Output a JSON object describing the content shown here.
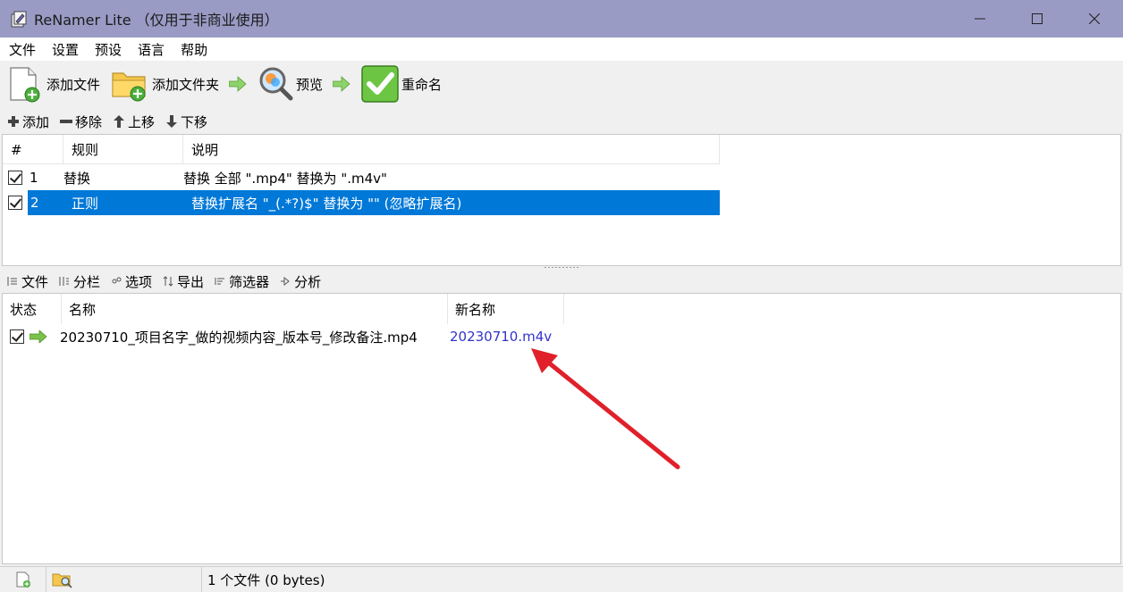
{
  "window": {
    "title": "ReNamer Lite （仅用于非商业使用）"
  },
  "menu": [
    "文件",
    "设置",
    "预设",
    "语言",
    "帮助"
  ],
  "toolbar": {
    "add_files": "添加文件",
    "add_folders": "添加文件夹",
    "preview": "预览",
    "rename": "重命名"
  },
  "rules_toolbar": {
    "add": "添加",
    "remove": "移除",
    "move_up": "上移",
    "move_down": "下移"
  },
  "rules_table": {
    "headers": [
      "#",
      "规则",
      "说明"
    ],
    "rows": [
      {
        "index": "1",
        "rule": "替换",
        "description": "替换 全部 \".mp4\" 替换为 \".m4v\"",
        "checked": true,
        "selected": false
      },
      {
        "index": "2",
        "rule": "正则",
        "description": "替换扩展名 \"_(.*?)$\" 替换为 \"\" (忽略扩展名)",
        "checked": true,
        "selected": true
      }
    ]
  },
  "files_toolbar": {
    "files": "文件",
    "columns": "分栏",
    "options": "选项",
    "export": "导出",
    "filters": "筛选器",
    "analyze": "分析"
  },
  "files_table": {
    "headers": [
      "状态",
      "名称",
      "新名称"
    ],
    "rows": [
      {
        "name": "20230710_项目名字_做的视频内容_版本号_修改备注.mp4",
        "new_name": "20230710.m4v",
        "checked": true
      }
    ]
  },
  "statusbar": {
    "file_count": "1 个文件 (0 bytes)"
  },
  "colors": {
    "titlebar": "#9a9bc5",
    "selection": "#0078d7",
    "new_name": "#3333cc",
    "annotation_arrow": "#e0202a"
  }
}
